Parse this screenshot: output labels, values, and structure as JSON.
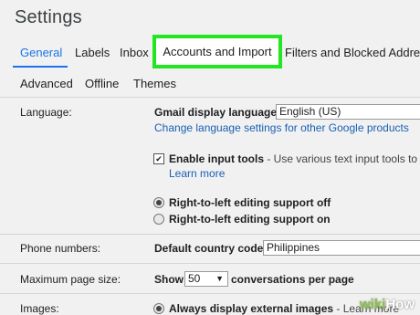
{
  "page": {
    "title": "Settings"
  },
  "tabs": [
    {
      "label": "General",
      "active": true
    },
    {
      "label": "Labels"
    },
    {
      "label": "Inbox"
    },
    {
      "label": "Accounts and Import",
      "highlighted": true
    },
    {
      "label": "Filters and Blocked Addres"
    }
  ],
  "subtabs": [
    {
      "label": "Advanced"
    },
    {
      "label": "Offline"
    },
    {
      "label": "Themes"
    }
  ],
  "language": {
    "label": "Language:",
    "display_label": "Gmail display language:",
    "display_value": "English (US)",
    "change_link": "Change language settings for other Google products",
    "input_tools_checked": true,
    "input_tools_bold": "Enable input tools",
    "input_tools_rest": " - Use various text input tools to t",
    "learn_more": "Learn more",
    "rtl_off": "Right-to-left editing support off",
    "rtl_on": "Right-to-left editing support on",
    "rtl_selected": "off"
  },
  "phone": {
    "label": "Phone numbers:",
    "country_label": "Default country code:",
    "country_value": "Philippines"
  },
  "page_size": {
    "label": "Maximum page size:",
    "show": "Show",
    "value": "50",
    "suffix": "conversations per page"
  },
  "images": {
    "label": "Images:",
    "option": "Always display external images",
    "option_rest": " - Learn more"
  },
  "watermark": {
    "prefix": "wiki",
    "suffix": "How"
  },
  "colors": {
    "accent": "#1a73e8",
    "highlight": "#22e622",
    "link": "#1a5fb4"
  },
  "icons": [
    "checkbox-checked-icon",
    "radio-selected-icon",
    "radio-unselected-icon",
    "dropdown-arrow-icon"
  ]
}
